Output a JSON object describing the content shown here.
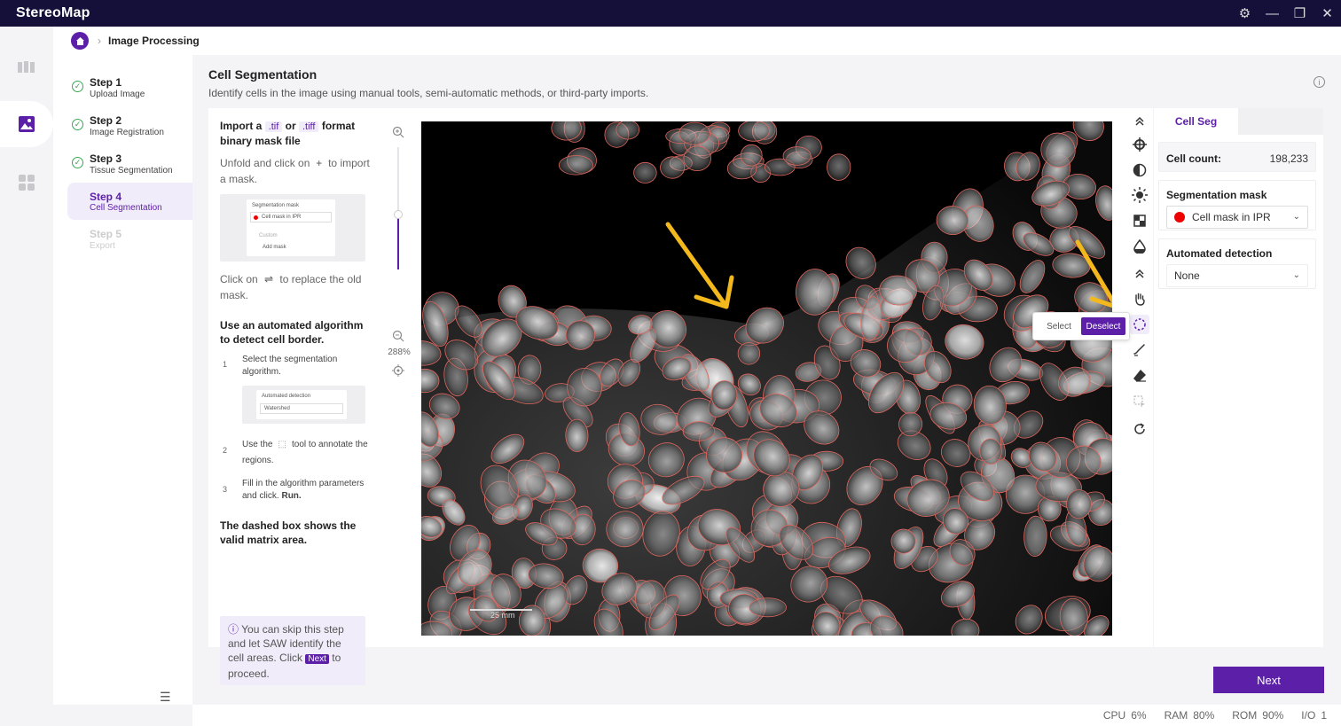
{
  "app": {
    "title": "StereoMap"
  },
  "window_controls": [
    "settings-icon",
    "minimize-icon",
    "restore-icon",
    "close-icon"
  ],
  "breadcrumb": {
    "current": "Image Processing"
  },
  "steps": [
    {
      "title": "Step 1",
      "subtitle": "Upload Image",
      "state": "done"
    },
    {
      "title": "Step 2",
      "subtitle": "Image Registration",
      "state": "done"
    },
    {
      "title": "Step 3",
      "subtitle": "Tissue Segmentation",
      "state": "done"
    },
    {
      "title": "Step 4",
      "subtitle": "Cell Segmentation",
      "state": "active"
    },
    {
      "title": "Step 5",
      "subtitle": "Export",
      "state": "disabled"
    }
  ],
  "page": {
    "title": "Cell Segmentation",
    "description": "Identify cells in the image using manual tools, semi-automatic methods, or third-party imports."
  },
  "guide": {
    "import_a": "Import a",
    "tif": ".tif",
    "or": "or",
    "tiff": ".tiff",
    "format": "format",
    "binary": "binary mask file",
    "unfold": "Unfold and click on",
    "to": "to",
    "import_mask": "import a mask.",
    "thumb1_title": "Segmentation mask",
    "thumb1_option": "Cell mask in IPR",
    "thumb1_custom": "Custom",
    "thumb1_add": "Add mask",
    "click_on": "Click on",
    "replace": "to replace the",
    "old_mask": "old mask.",
    "auto_heading": "Use an automated algorithm to detect cell border.",
    "step1_num": "1",
    "step1_text": "Select the segmentation algorithm.",
    "thumb2_title": "Automated detection",
    "thumb2_value": "Watershed",
    "step2_num": "2",
    "step2_pre": "Use the",
    "step2_post": "tool to annotate the regions.",
    "step3_num": "3",
    "step3_text": "Fill in the algorithm parameters and click.",
    "step3_run": "Run.",
    "dashed_note": "The dashed box shows the valid matrix area.",
    "tip_pre": "You can skip this step and let SAW identify the cell areas. Click",
    "tip_next": "Next",
    "tip_post": "to proceed."
  },
  "zoom": {
    "level": "288%",
    "level_fraction": 0.45
  },
  "scale_bar": {
    "label": "25 mm"
  },
  "toolbar": [
    "collapse-up-icon",
    "move-icon",
    "contrast-icon",
    "brightness-icon",
    "grid-icon",
    "drop-icon",
    "collapse-up-icon",
    "hand-icon",
    "lasso-select-icon",
    "brush-icon",
    "eraser-icon",
    "region-select-icon",
    "refresh-icon"
  ],
  "popover": {
    "select": "Select",
    "deselect": "Deselect"
  },
  "right_panel": {
    "tab": "Cell Seg",
    "cell_count_label": "Cell count:",
    "cell_count_value": "198,233",
    "mask_label": "Segmentation mask",
    "mask_value": "Cell mask in IPR",
    "mask_color": "#e00000",
    "detect_label": "Automated detection",
    "detect_value": "None"
  },
  "next_button": "Next",
  "status": {
    "cpu_label": "CPU",
    "cpu_value": "6%",
    "ram_label": "RAM",
    "ram_value": "80%",
    "rom_label": "ROM",
    "rom_value": "90%",
    "io_label": "I/O",
    "io_value": "1"
  },
  "colors": {
    "accent": "#5b1fa8",
    "titlebar": "#14103a",
    "done": "#3aa655",
    "annotation_arrow": "#f2b81c"
  }
}
